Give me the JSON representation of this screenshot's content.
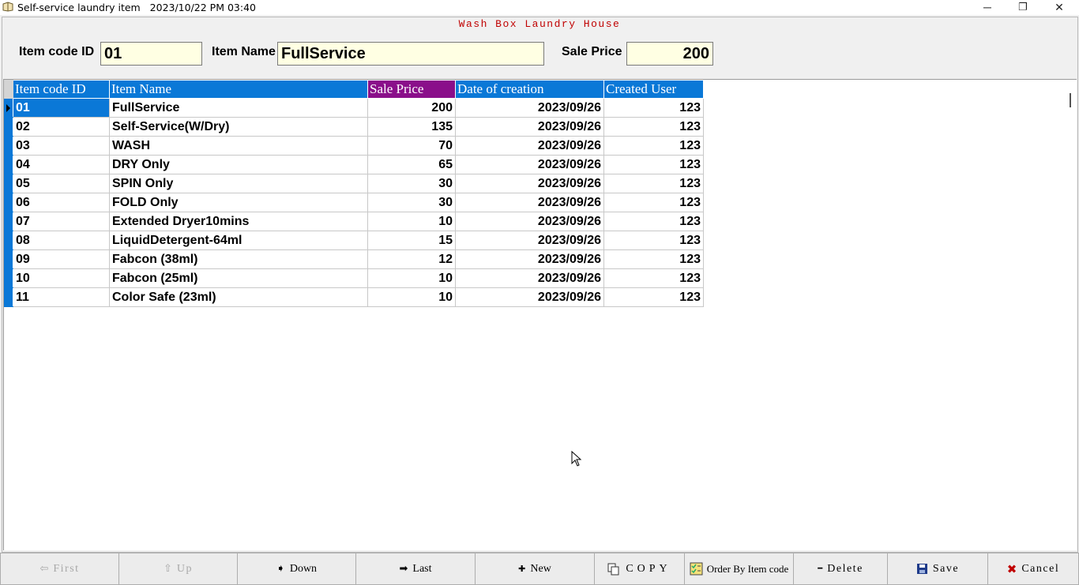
{
  "window": {
    "title": "Self-service laundry item   2023/10/22 PM 03:40",
    "minimize_glyph": "─",
    "maximize_glyph": "❐",
    "close_glyph": "✕"
  },
  "header": {
    "company": "Wash Box Laundry House"
  },
  "form": {
    "item_code_label": "Item code ID",
    "item_code_value": "01",
    "item_name_label": "Item Name",
    "item_name_value": "FullService",
    "sale_price_label": "Sale Price",
    "sale_price_value": "200"
  },
  "grid": {
    "columns": [
      "Item code ID",
      "Item Name",
      "Sale Price",
      "Date of creation",
      "Created User"
    ],
    "sorted_column": "Sale Price",
    "rows": [
      [
        "01",
        "FullService",
        "200",
        "2023/09/26",
        "123"
      ],
      [
        "02",
        "Self-Service(W/Dry)",
        "135",
        "2023/09/26",
        "123"
      ],
      [
        "03",
        "WASH",
        "70",
        "2023/09/26",
        "123"
      ],
      [
        "04",
        "DRY Only",
        "65",
        "2023/09/26",
        "123"
      ],
      [
        "05",
        "SPIN Only",
        "30",
        "2023/09/26",
        "123"
      ],
      [
        "06",
        "FOLD Only",
        "30",
        "2023/09/26",
        "123"
      ],
      [
        "07",
        "Extended Dryer10mins",
        "10",
        "2023/09/26",
        "123"
      ],
      [
        "08",
        "LiquidDetergent-64ml",
        "15",
        "2023/09/26",
        "123"
      ],
      [
        "09",
        "Fabcon (38ml)",
        "12",
        "2023/09/26",
        "123"
      ],
      [
        "10",
        "Fabcon (25ml)",
        "10",
        "2023/09/26",
        "123"
      ],
      [
        "11",
        "Color Safe (23ml)",
        "10",
        "2023/09/26",
        "123"
      ]
    ]
  },
  "buttons": {
    "first": "First",
    "up": "Up",
    "down": "Down",
    "last": "Last",
    "new": "New",
    "copy": "COPY",
    "order": "Order By Item code",
    "delete": "Delete",
    "save": "Save",
    "cancel": "Cancel"
  },
  "icons": {
    "first": "⇦",
    "up": "⇧",
    "down": "➧",
    "last": "➡",
    "new": "✚",
    "delete": "━",
    "cancel": "✖"
  },
  "colors": {
    "accent": "#0a78d7",
    "sorted_header": "#8a0f8a",
    "company_text": "#c00000",
    "field_bg": "#ffffe3"
  }
}
